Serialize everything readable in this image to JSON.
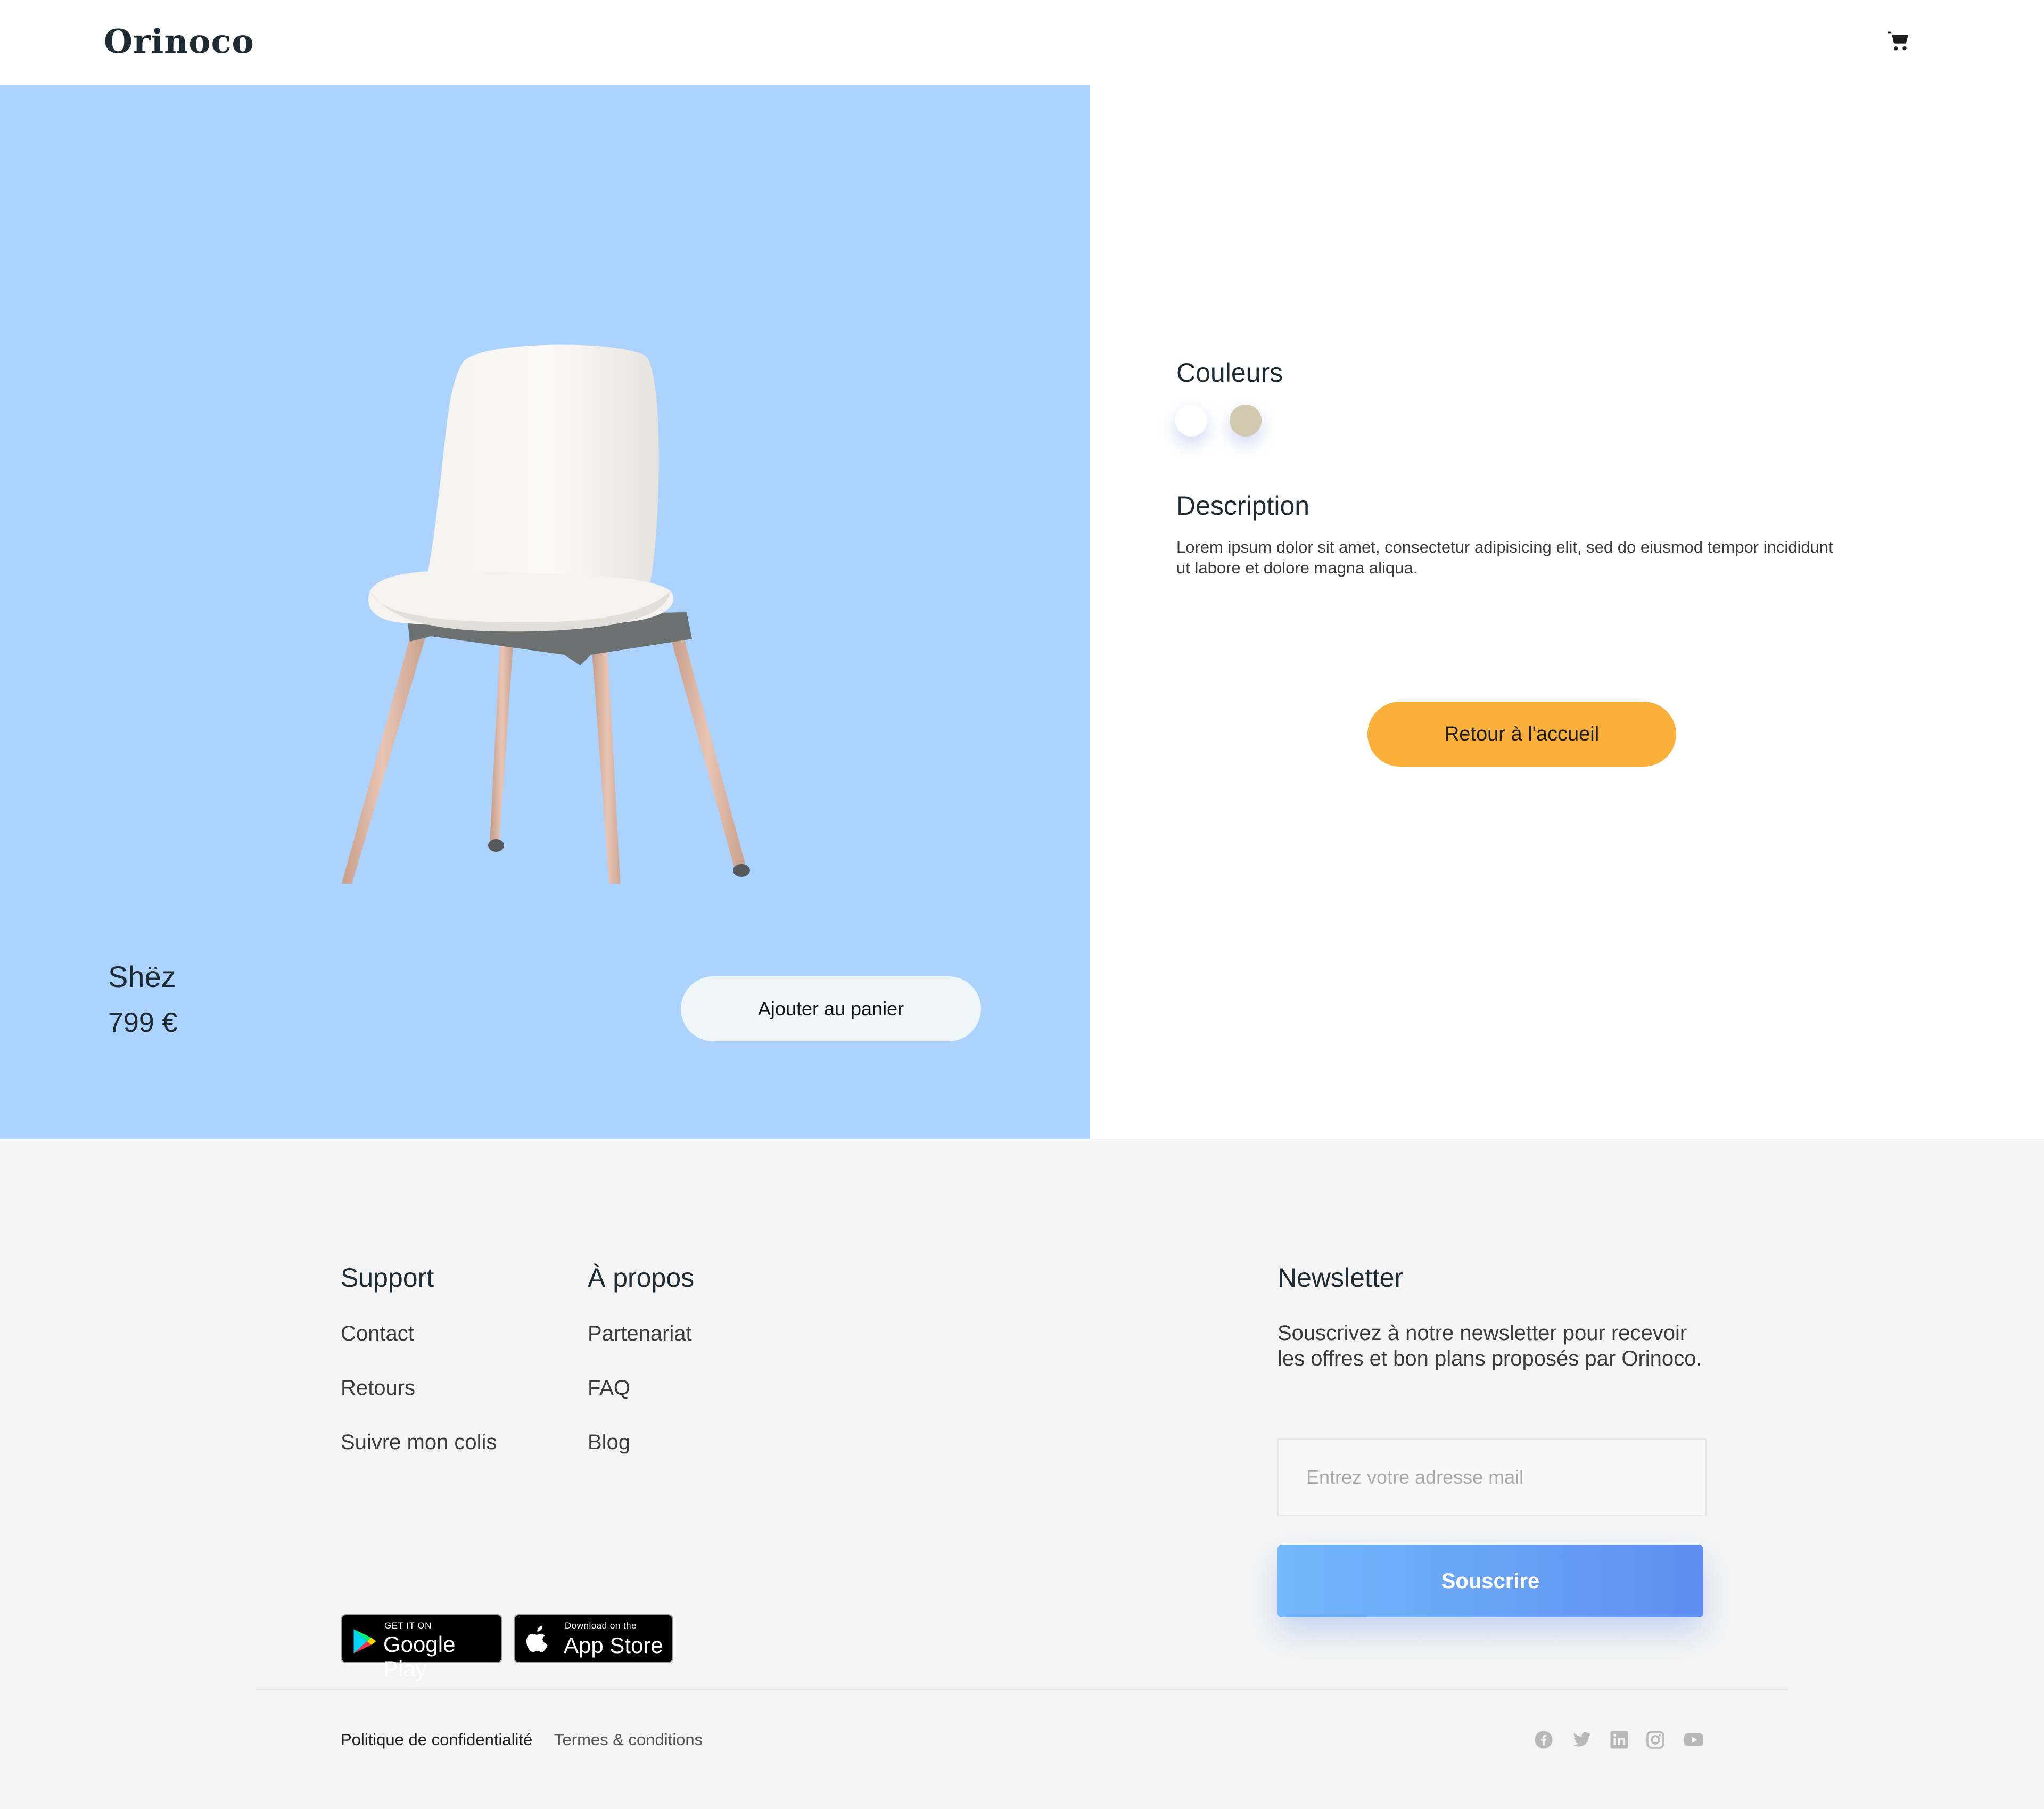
{
  "brand": {
    "logo": "Orinoco"
  },
  "header": {
    "cart_icon": "shopping-cart-icon"
  },
  "product": {
    "name": "Shëz",
    "price": "799 €",
    "add_to_cart_label": "Ajouter au panier",
    "background_color": "#acd3fd",
    "image": "white-chair-wooden-legs"
  },
  "details": {
    "colors_title": "Couleurs",
    "colors": [
      "#ffffff",
      "#d2c9ae"
    ],
    "description_title": "Description",
    "description_text": "Lorem ipsum dolor sit amet, consectetur adipisicing elit, sed do eiusmod tempor incididunt ut labore et dolore magna aliqua.",
    "back_home_label": "Retour à l'accueil",
    "accent_color": "#fbb03b"
  },
  "footer": {
    "support": {
      "title": "Support",
      "links": [
        "Contact",
        "Retours",
        "Suivre mon colis"
      ]
    },
    "about": {
      "title": "À propos",
      "links": [
        "Partenariat",
        "FAQ",
        "Blog"
      ]
    },
    "newsletter": {
      "title": "Newsletter",
      "text": "Souscrivez à notre newsletter pour recevoir les offres et bon plans proposés par Orinoco.",
      "input_placeholder": "Entrez votre adresse mail",
      "input_value": "",
      "button_label": "Souscrire"
    },
    "badges": {
      "google": {
        "small": "GET IT ON",
        "big": "Google Play"
      },
      "apple": {
        "small": "Download on the",
        "big": "App Store"
      }
    },
    "legal": {
      "privacy": "Politique de confidentialité",
      "terms": "Termes & conditions"
    },
    "social_icons": [
      "facebook-icon",
      "twitter-icon",
      "linkedin-icon",
      "instagram-icon",
      "youtube-icon"
    ]
  }
}
